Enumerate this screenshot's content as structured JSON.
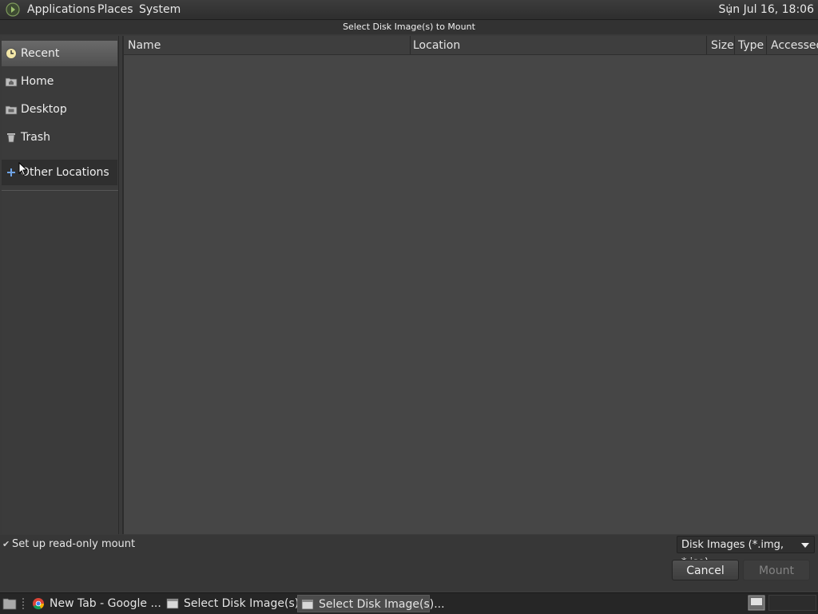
{
  "top_panel": {
    "menus": [
      "Applications",
      "Places",
      "System"
    ],
    "clock": "Sun Jul 16, 18:06"
  },
  "dialog": {
    "title": "Select Disk Image(s) to Mount",
    "sidebar": {
      "items": [
        {
          "label": "Recent",
          "icon": "clock-icon"
        },
        {
          "label": "Home",
          "icon": "home-folder-icon"
        },
        {
          "label": "Desktop",
          "icon": "desktop-folder-icon"
        },
        {
          "label": "Trash",
          "icon": "trash-icon"
        }
      ],
      "other_locations": {
        "label": "Other Locations",
        "icon": "plus-icon"
      }
    },
    "columns": [
      "Name",
      "Location",
      "Size",
      "Type",
      "Accessed"
    ],
    "files": [],
    "readonly_label": "Set up read-only mount",
    "readonly_checked": true,
    "filter": "Disk Images (*.img, *.iso)",
    "cancel_label": "Cancel",
    "mount_label": "Mount",
    "mount_enabled": false
  },
  "taskbar": {
    "tasks": [
      {
        "label": "New Tab - Google ...",
        "icon": "chrome-icon",
        "active": false
      },
      {
        "label": "Select Disk Image(s)...",
        "icon": "window-icon",
        "active": false
      },
      {
        "label": "Select Disk Image(s)...",
        "icon": "window-icon",
        "active": true
      }
    ]
  },
  "colors": {
    "background": "#3a3a3a",
    "selected_item": "#5c5c5c",
    "disabled_text": "#838383"
  }
}
